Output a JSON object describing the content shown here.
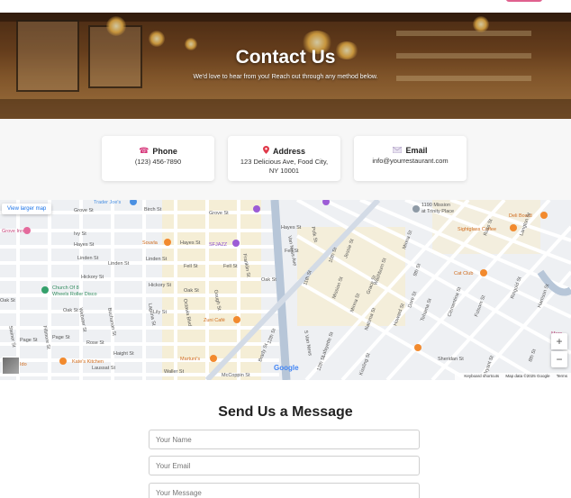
{
  "hero": {
    "title": "Contact Us",
    "subtitle": "We'd love to hear from you! Reach out through any method below."
  },
  "contact_cards": [
    {
      "icon": "phone-icon",
      "label": "Phone",
      "value": "(123) 456-7890"
    },
    {
      "icon": "map-pin-icon",
      "label": "Address",
      "value": "123 Delicious Ave, Food City, NY 10001"
    },
    {
      "icon": "envelope-icon",
      "label": "Email",
      "value": "info@yourrestaurant.com"
    }
  ],
  "map": {
    "view_larger": "View larger map",
    "zoom_in": "+",
    "zoom_out": "−",
    "google_logo": "Google",
    "keyboard_shortcuts": "Keyboard shortcuts",
    "map_data": "Map data ©2025 Google",
    "terms": "Terms",
    "streets": [
      "Grove St",
      "Ivy St",
      "Hayes St",
      "Linden St",
      "Fell St",
      "Oak St",
      "Lily St",
      "Page St",
      "Rose St",
      "Haight St",
      "Laussat St",
      "Waller St",
      "McCoppin St",
      "Birch St",
      "Hickory St",
      "Buchanan St",
      "Laguna St",
      "Octavia Blvd",
      "Gough St",
      "Franklin St",
      "Brady St",
      "12th St",
      "11th St",
      "10th St",
      "9th St",
      "8th St",
      "Van Ness Ave",
      "S Van Ness",
      "Polk St",
      "Larkin St",
      "Market St",
      "Mission St",
      "Minna St",
      "Natoma St",
      "Howard St",
      "Folsom St",
      "Harrison St",
      "Bryant St",
      "Lafayette St",
      "Jessie St",
      "Washburn St",
      "Grace St",
      "Tehama St",
      "Clementina St",
      "Dore St",
      "Ringold St",
      "Sheridan St",
      "Russ St",
      "Langton St",
      "Webster St",
      "Fillmore St",
      "Steiner St",
      "Kissling St",
      "Hermann St"
    ],
    "places": [
      "Trader Joe's",
      "Grove Inn",
      "Souvla",
      "SFJAZZ",
      "Church Of 8 Wheels Roller Disco",
      "Zuni Café",
      "Martuni's",
      "Kate's Kitchen",
      "1190 Mission at Trinity Place",
      "Deli Board",
      "Sightglass Coffee",
      "Cat Club",
      "Ido"
    ],
    "colors": {
      "road": "#ffffff",
      "highway": "#b7c6d8",
      "land": "#eef0f3",
      "park": "#f8ecc9",
      "poi_orange": "#f28a2e",
      "poi_purple": "#9c5cd6",
      "poi_green": "#34a06b"
    }
  },
  "form": {
    "title": "Send Us a Message",
    "name_placeholder": "Your Name",
    "email_placeholder": "Your Email",
    "message_placeholder": "Your Message"
  }
}
